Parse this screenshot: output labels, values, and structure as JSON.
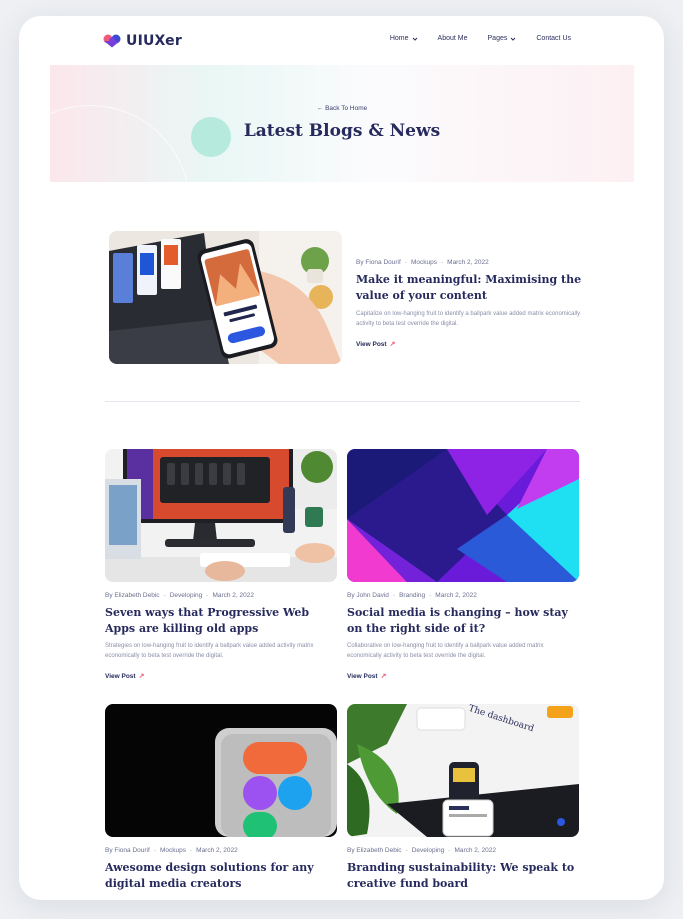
{
  "brand": {
    "name": "UIUXer"
  },
  "nav": [
    {
      "label": "Home",
      "has_dropdown": true
    },
    {
      "label": "About Me",
      "has_dropdown": false
    },
    {
      "label": "Pages",
      "has_dropdown": true
    },
    {
      "label": "Contact Us",
      "has_dropdown": false
    }
  ],
  "hero": {
    "back_label": "← Back To Home",
    "title": "Latest Blogs & News"
  },
  "featured": {
    "author": "By Fiona Dourif",
    "category": "Mockups",
    "date": "March 2, 2022",
    "title": "Make it meaningful: Maximising the value of your content",
    "excerpt": "Capitalize on low-hanging fruit to identify a ballpark value added matrix economically activity to beta test override the digital.",
    "link": "View Post"
  },
  "posts": [
    {
      "author": "By Elizabeth Debic",
      "category": "Developing",
      "date": "March 2, 2022",
      "title": "Seven ways that Progressive Web Apps are killing old apps",
      "excerpt": "Strategies on low-hanging fruit to identify a ballpark value added activity matrix economically to beta test override the digital.",
      "link": "View Post"
    },
    {
      "author": "By John David",
      "category": "Branding",
      "date": "March 2, 2022",
      "title": "Social media is changing – how stay on the right side of it?",
      "excerpt": "Collaborative on low-hanging fruit to identify a ballpark value added matrix economically activity to beta test override the digital.",
      "link": "View Post"
    },
    {
      "author": "By Fiona Dourif",
      "category": "Mockups",
      "date": "March 2, 2022",
      "title": "Awesome design solutions for any digital media creators"
    },
    {
      "author": "By Elizabeth Debic",
      "category": "Developing",
      "date": "March 2, 2022",
      "title": "Branding sustainability: We speak to creative fund board"
    }
  ],
  "colors": {
    "primary": "#262a5c",
    "accent": "#ef5b7b",
    "mint": "#b5eadc"
  }
}
